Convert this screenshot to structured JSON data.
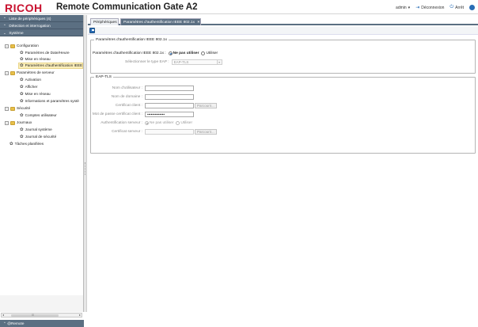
{
  "header": {
    "brand": "RICOH",
    "title": "Remote Communication Gate A2",
    "user_label": "admin",
    "logout_label": "Déconnexion",
    "stop_label": "Arrêt"
  },
  "sidebar": {
    "accordion": [
      {
        "label": "Liste de périphériques (4)"
      },
      {
        "label": "Détection et interrogation"
      },
      {
        "label": "Système"
      }
    ],
    "tree": [
      {
        "label": "Configuration"
      },
      {
        "label": "Paramètres de Date/Heure"
      },
      {
        "label": "Mise en réseau"
      },
      {
        "label": "Paramètres d'authentification IEEE"
      },
      {
        "label": "Paramètres de serveur"
      },
      {
        "label": "Activation"
      },
      {
        "label": "Afficher"
      },
      {
        "label": "Mise en réseau"
      },
      {
        "label": "Informations et paramètres systè"
      },
      {
        "label": "Sécurité"
      },
      {
        "label": "Comptes utilisateur"
      },
      {
        "label": "Journaux"
      },
      {
        "label": "Journal système"
      },
      {
        "label": "Journal de sécurité"
      },
      {
        "label": "Tâches planifiées"
      }
    ],
    "footer_label": "@Remote",
    "scroll_text": "III"
  },
  "tabs": [
    {
      "label": "Périphériques"
    },
    {
      "label": "Paramètres d'authentification IEEE 802.1x"
    }
  ],
  "auth_section": {
    "legend": "Paramètres d'authentification IEEE 802.1x",
    "field_label": "Paramètres d'authentification IEEE 802.1x :",
    "option_off": "Ne pas utiliser",
    "option_on": "Utiliser",
    "eap_type_label": "Sélectionner le type EAP :",
    "eap_type_value": "EAP-TLS",
    "selected": "off"
  },
  "eap_section": {
    "legend": "EAP-TLS",
    "username_label": "Nom d'utilisateur :",
    "domain_label": "Nom de domaine :",
    "client_cert_label": "Certificat client :",
    "browse_label": "Parcourir...",
    "cert_password_label": "Mot de passe certificat client :",
    "cert_password_value": "••••••••••••••",
    "server_auth_label": "Authentification serveur :",
    "server_auth_off": "Ne pas utiliser",
    "server_auth_on": "Utiliser",
    "server_cert_label": "Certificat serveur :",
    "browse_label2": "Parcourir..."
  },
  "colors": {
    "brand_red": "#c8102e",
    "nav_bar": "#5b6f82",
    "accent": "#2a6db5",
    "selection": "#fbeeb9"
  }
}
